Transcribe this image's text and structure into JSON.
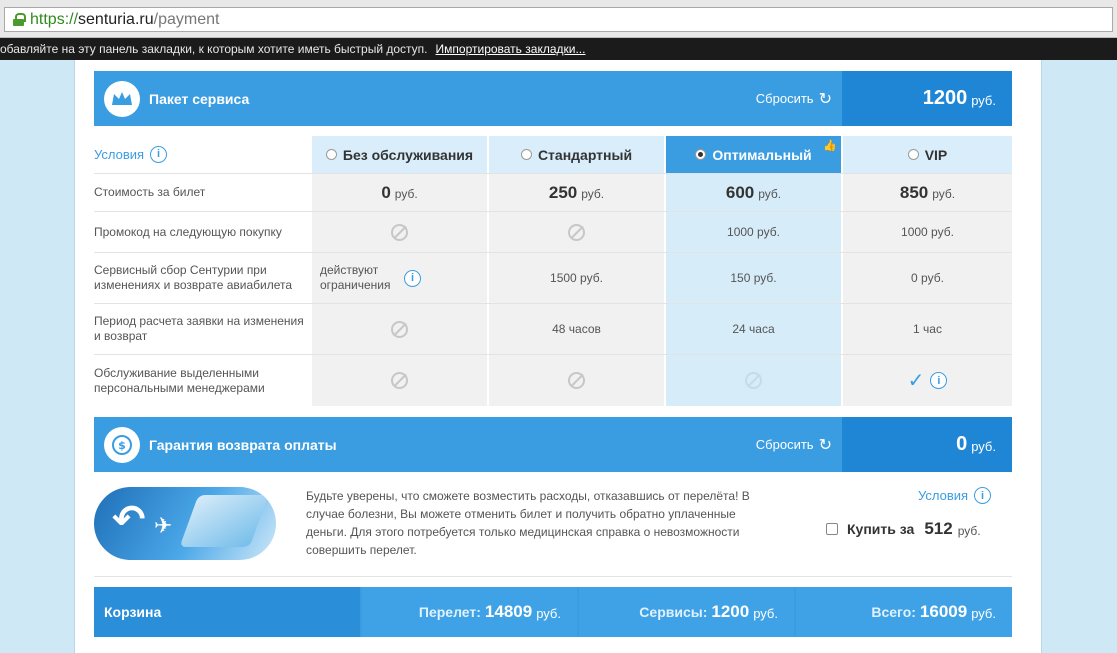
{
  "browser": {
    "url_scheme": "https://",
    "url_host": "senturia.ru",
    "url_path": "/payment",
    "bookmarks_hint": "обавляйте на эту панель закладки, к которым хотите иметь быстрый доступ.",
    "import_link": "Импортировать закладки..."
  },
  "service": {
    "title": "Пакет сервиса",
    "reset_label": "Сбросить",
    "price_value": "1200",
    "currency": "руб.",
    "conditions_label": "Условия",
    "plans": [
      {
        "name": "Без обслуживания",
        "selected": false
      },
      {
        "name": "Стандартный",
        "selected": false
      },
      {
        "name": "Оптимальный",
        "selected": true
      },
      {
        "name": "VIP",
        "selected": false
      }
    ],
    "rows": {
      "cost": {
        "label": "Стоимость за билет",
        "values": [
          "0",
          "250",
          "600",
          "850"
        ]
      },
      "promo": {
        "label": "Промокод на следующую покупку",
        "values": [
          "",
          "",
          "1000 руб.",
          "1000 руб."
        ]
      },
      "fee": {
        "label": "Сервисный сбор Сентурии при изменениях и возврате авиабилета",
        "values": [
          "действуют ограничения",
          "1500 руб.",
          "150 руб.",
          "0 руб."
        ]
      },
      "period": {
        "label": "Период расчета заявки на изменения и возврат",
        "values": [
          "",
          "48 часов",
          "24 часа",
          "1 час"
        ]
      },
      "managers": {
        "label": "Обслуживание выделенными персональными менеджерами",
        "values": [
          "",
          "",
          "",
          ""
        ]
      }
    }
  },
  "guarantee": {
    "title": "Гарантия возврата оплаты",
    "reset_label": "Сбросить",
    "price_value": "0",
    "currency": "руб.",
    "description": "Будьте уверены, что сможете возместить расходы, отказавшись от перелёта! В случае болезни, Вы можете отменить билет и получить обратно уплаченные деньги. Для этого потребуется только медицинская справка о невозможности совершить перелет.",
    "conditions_label": "Условия",
    "buy_label": "Купить за",
    "buy_value": "512",
    "buy_currency": "руб."
  },
  "cart": {
    "title": "Корзина",
    "flight_label": "Перелет:",
    "flight_value": "14809",
    "services_label": "Сервисы:",
    "services_value": "1200",
    "total_label": "Всего:",
    "total_value": "16009",
    "currency": "руб."
  },
  "colors": {
    "accent": "#3a9de2",
    "accent_dark": "#1f86d6",
    "highlight_col": "#d6ecf9",
    "url_green": "#2f8a1f"
  },
  "icons": {
    "crown": "crown-icon",
    "refund": "refund-coin-icon",
    "refresh": "refresh-icon",
    "info": "info-icon",
    "not_available": "not-available-icon",
    "check": "checkmark-icon",
    "thumb": "thumbs-up-icon"
  }
}
